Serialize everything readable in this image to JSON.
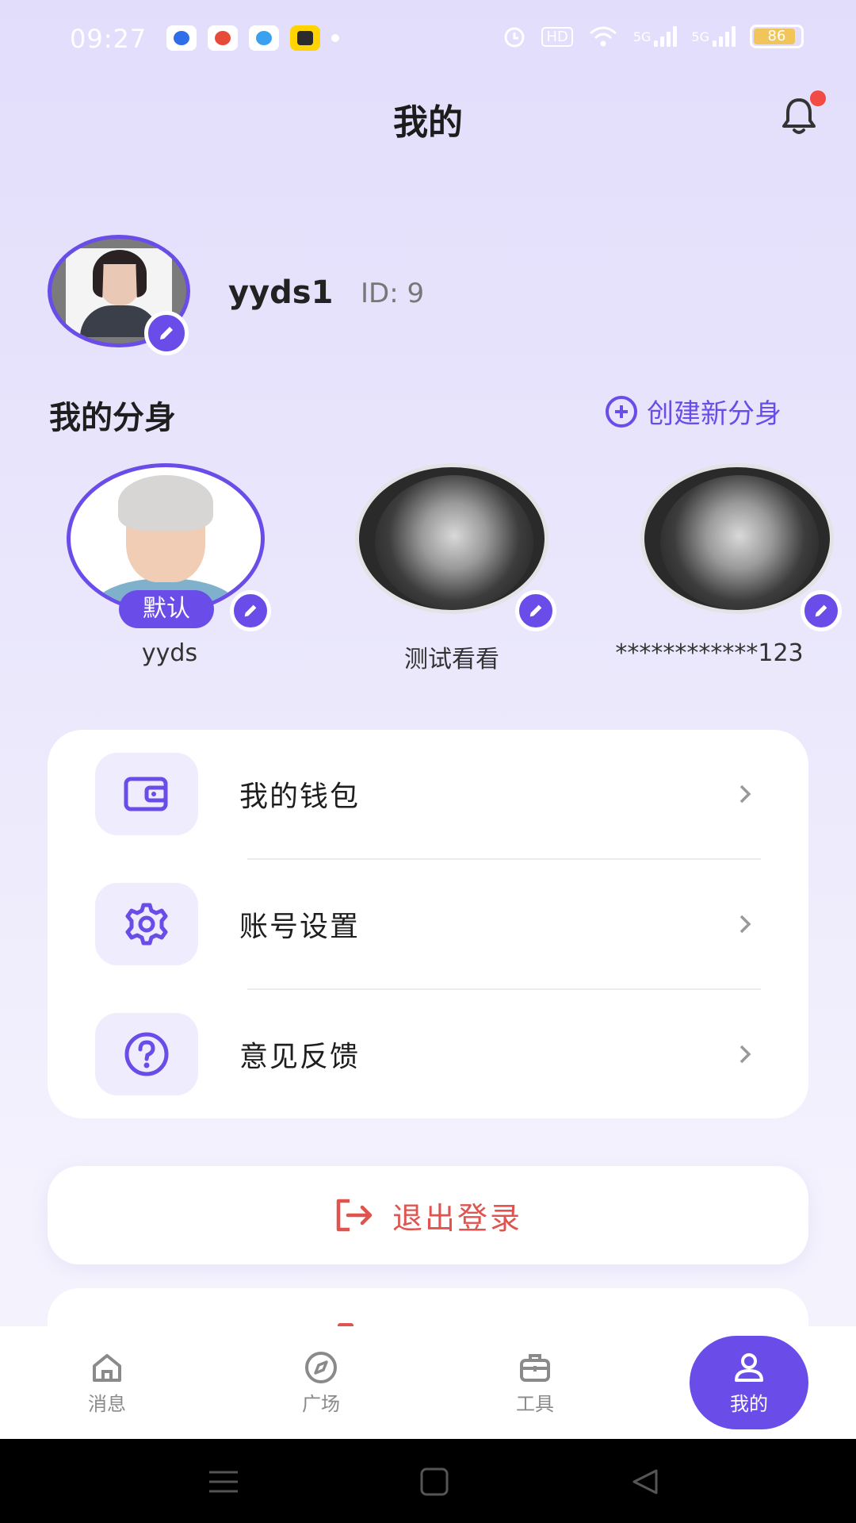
{
  "status_bar": {
    "time": "09:27",
    "battery": "86",
    "hd": "HD",
    "net1": "5G",
    "net2": "5G"
  },
  "header": {
    "title": "我的"
  },
  "profile": {
    "username": "yyds1",
    "id_label": "ID: 9"
  },
  "clones": {
    "title": "我的分身",
    "create_label": "创建新分身",
    "items": [
      {
        "name": "yyds",
        "default_tag": "默认"
      },
      {
        "name": "测试看看"
      },
      {
        "name": "************123"
      }
    ]
  },
  "menu": {
    "items": [
      {
        "label": "我的钱包",
        "icon": "wallet-icon"
      },
      {
        "label": "账号设置",
        "icon": "gear-icon"
      },
      {
        "label": "意见反馈",
        "icon": "help-icon"
      }
    ]
  },
  "logout": {
    "label": "退出登录"
  },
  "tabbar": {
    "items": [
      {
        "label": "消息",
        "icon": "home-icon"
      },
      {
        "label": "广场",
        "icon": "compass-icon"
      },
      {
        "label": "工具",
        "icon": "toolbox-icon"
      },
      {
        "label": "我的",
        "icon": "user-icon",
        "active": true
      }
    ]
  },
  "colors": {
    "accent": "#6a4de8",
    "danger": "#e05450",
    "notification": "#f24a45"
  }
}
